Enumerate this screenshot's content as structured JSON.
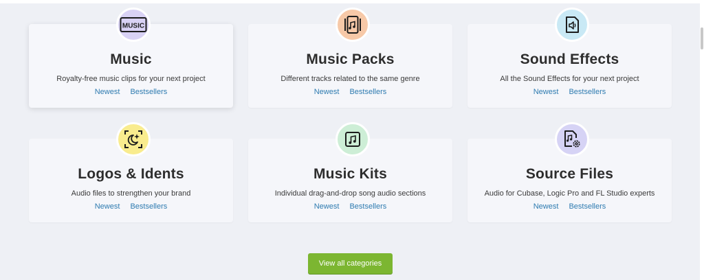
{
  "categories": [
    {
      "title": "Music",
      "description": "Royalty-free music clips for your next project",
      "newest": "Newest",
      "bestsellers": "Bestsellers",
      "icon": "music-label-icon",
      "icon_text": "MUSIC",
      "badge_color": "#d9d2f5"
    },
    {
      "title": "Music Packs",
      "description": "Different tracks related to the same genre",
      "newest": "Newest",
      "bestsellers": "Bestsellers",
      "icon": "music-pack-icon",
      "badge_color": "#f7c9a8"
    },
    {
      "title": "Sound Effects",
      "description": "All the Sound Effects for your next project",
      "newest": "Newest",
      "bestsellers": "Bestsellers",
      "icon": "speaker-file-icon",
      "badge_color": "#c9e9f5"
    },
    {
      "title": "Logos & Idents",
      "description": "Audio files to strengthen your brand",
      "newest": "Newest",
      "bestsellers": "Bestsellers",
      "icon": "moon-sparkle-icon",
      "badge_color": "#f9ec8e"
    },
    {
      "title": "Music Kits",
      "description": "Individual drag-and-drop song audio sections",
      "newest": "Newest",
      "bestsellers": "Bestsellers",
      "icon": "music-note-box-icon",
      "badge_color": "#cdeed6"
    },
    {
      "title": "Source Files",
      "description": "Audio for Cubase, Logic Pro and FL Studio experts",
      "newest": "Newest",
      "bestsellers": "Bestsellers",
      "icon": "music-file-gear-icon",
      "badge_color": "#d6d3f5"
    }
  ],
  "view_all_label": "View all categories",
  "colors": {
    "link": "#2e7bb0",
    "button": "#7cb631",
    "card": "#f5f6fa",
    "background": "#eef0f5"
  }
}
